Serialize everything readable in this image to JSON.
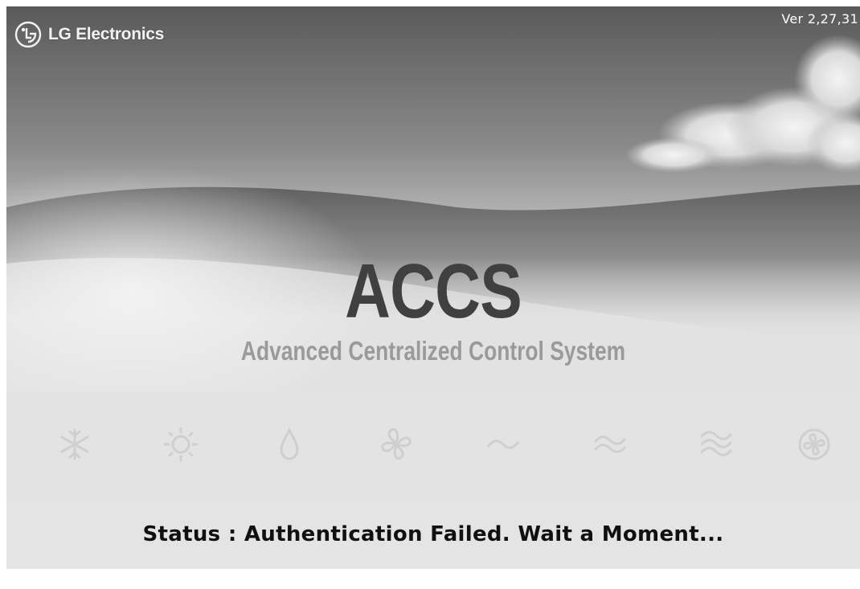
{
  "brand": {
    "name": "LG Electronics",
    "logo_icon": "lg-logo-icon"
  },
  "version": "Ver 2,27,31",
  "app": {
    "title": "ACCS",
    "subtitle": "Advanced Centralized Control System"
  },
  "modes": [
    {
      "icon": "snowflake-icon"
    },
    {
      "icon": "sun-icon"
    },
    {
      "icon": "drop-icon"
    },
    {
      "icon": "fan-icon"
    },
    {
      "icon": "wave-icon"
    },
    {
      "icon": "double-wave-icon"
    },
    {
      "icon": "triple-wave-icon"
    },
    {
      "icon": "circle-fan-icon"
    }
  ],
  "status": {
    "label": "Status",
    "separator": ":",
    "message": "Authentication Failed. Wait a Moment..."
  }
}
